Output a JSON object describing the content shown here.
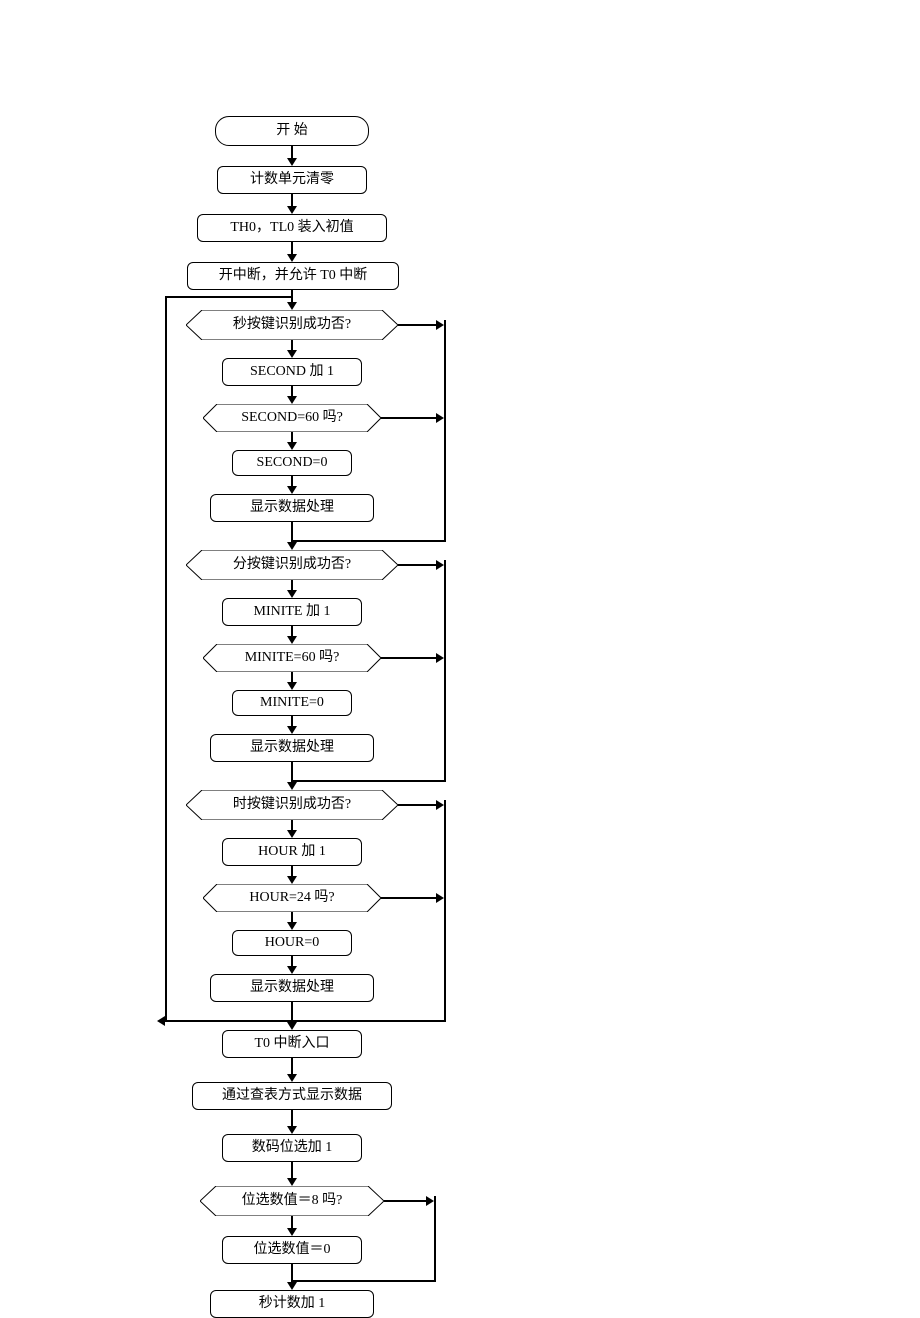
{
  "chart_data": {
    "type": "flowchart",
    "title": "",
    "nodes": {
      "start": {
        "type": "terminator",
        "text": "开   始"
      },
      "clear": {
        "type": "process",
        "text": "计数单元清零"
      },
      "load": {
        "type": "process",
        "text": "TH0，TL0 装入初值"
      },
      "int_on": {
        "type": "process",
        "text": "开中断，并允许 T0 中断"
      },
      "d_sec": {
        "type": "decision",
        "text": "秒按键识别成功否?"
      },
      "sec_inc": {
        "type": "process",
        "text": "SECOND 加 1"
      },
      "d_sec60": {
        "type": "decision",
        "text": "SECOND=60 吗?"
      },
      "sec_zero": {
        "type": "process",
        "text": "SECOND=0"
      },
      "disp1": {
        "type": "process",
        "text": "显示数据处理"
      },
      "d_min": {
        "type": "decision",
        "text": "分按键识别成功否?"
      },
      "min_inc": {
        "type": "process",
        "text": "MINITE 加 1"
      },
      "d_min60": {
        "type": "decision",
        "text": "MINITE=60 吗?"
      },
      "min_zero": {
        "type": "process",
        "text": "MINITE=0"
      },
      "disp2": {
        "type": "process",
        "text": "显示数据处理"
      },
      "d_hour": {
        "type": "decision",
        "text": "时按键识别成功否?"
      },
      "hour_inc": {
        "type": "process",
        "text": "HOUR 加 1"
      },
      "d_hour24": {
        "type": "decision",
        "text": "HOUR=24 吗?"
      },
      "hour_zero": {
        "type": "process",
        "text": "HOUR=0"
      },
      "disp3": {
        "type": "process",
        "text": "显示数据处理"
      },
      "t0_entry": {
        "type": "process",
        "text": "T0 中断入口"
      },
      "lookup": {
        "type": "process",
        "text": "通过查表方式显示数据"
      },
      "digit_inc": {
        "type": "process",
        "text": "数码位选加 1"
      },
      "d_digit8": {
        "type": "decision",
        "text": "位选数值＝8 吗?"
      },
      "digit_zero": {
        "type": "process",
        "text": "位选数值＝0"
      },
      "sec_cnt": {
        "type": "process",
        "text": "秒计数加 1"
      }
    },
    "edges_note": "Decision right=No, down=Yes. After disp3 a loop line goes left and back up to before d_sec."
  }
}
